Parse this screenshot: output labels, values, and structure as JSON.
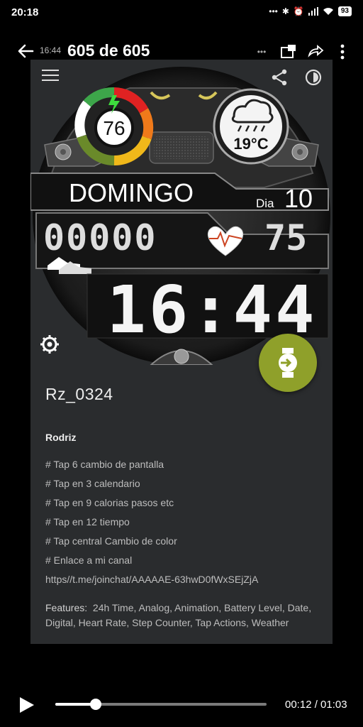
{
  "status_bar": {
    "time": "20:18",
    "dots": "•••",
    "battery": "93"
  },
  "topbar": {
    "small_time": "16:44",
    "title": "605 de 605"
  },
  "watch": {
    "battery_level": "76",
    "temperature": "19°C",
    "day_name": "DOMINGO",
    "dia_label": "Dia",
    "day_number": "10",
    "steps": "00000",
    "heart_rate": "75",
    "time": "16:44"
  },
  "details": {
    "title": "Rz_0324",
    "author": "Rodriz",
    "lines": [
      "# Tap 6 cambio de pantalla",
      "# Tap en 3 calendario",
      "# Tap en 9 calorias pasos etc",
      "# Tap en 12 tiempo",
      "# Tap central Cambio de color",
      "# Enlace a mi canal",
      "https//t.me/joinchat/AAAAAE-63hwD0fWxSEjZjA"
    ],
    "features_label": "Features:",
    "features": "24h Time,  Analog,  Animation,  Battery Level,  Date,  Digital,  Heart Rate,  Step Counter,  Tap Actions,  Weather"
  },
  "player": {
    "time_readout": "00:12 / 01:03",
    "progress": 0.19
  },
  "colors": {
    "accent_fab": "#8fa02a",
    "panel": "#2a2c2e"
  }
}
